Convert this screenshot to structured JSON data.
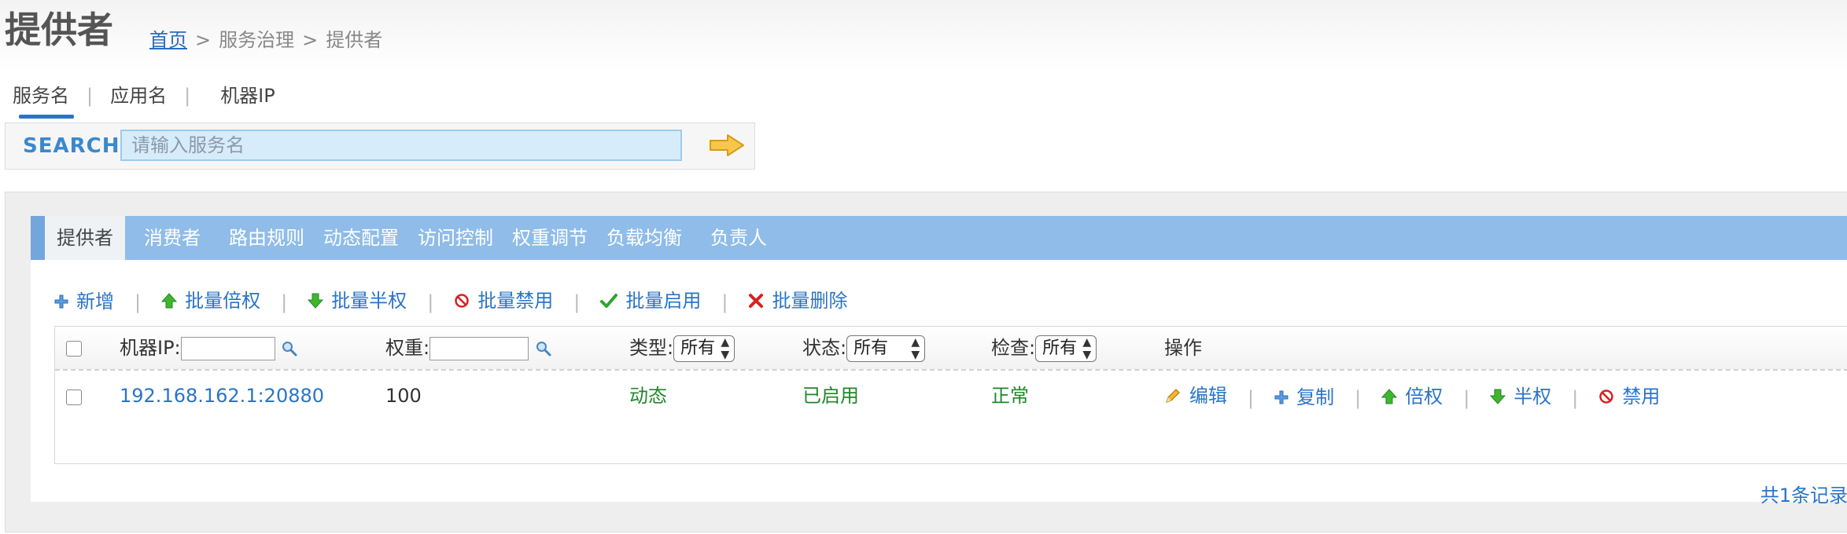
{
  "header": {
    "title": "提供者",
    "breadcrumb": {
      "home": "首页",
      "sep1": ">",
      "level2": "服务治理",
      "sep2": ">",
      "level3": "提供者"
    }
  },
  "search_tabs": {
    "items": [
      "服务名",
      "应用名",
      "机器IP"
    ],
    "active": "服务名",
    "divider": "|"
  },
  "search": {
    "label": "SEARCH",
    "placeholder": "请输入服务名",
    "value": ""
  },
  "tabs": {
    "items": [
      "提供者",
      "消费者",
      "路由规则",
      "动态配置",
      "访问控制",
      "权重调节",
      "负载均衡",
      "负责人"
    ],
    "active": "提供者"
  },
  "toolbar": {
    "add": "新增",
    "batch_double": "批量倍权",
    "batch_half": "批量半权",
    "batch_disable": "批量禁用",
    "batch_enable": "批量启用",
    "batch_delete": "批量删除",
    "divider": "|"
  },
  "table": {
    "headers": {
      "ip": "机器IP:",
      "weight": "权重:",
      "type": "类型:",
      "status": "状态:",
      "check": "检查:",
      "actions": "操作"
    },
    "filters": {
      "type": "所有",
      "status": "所有",
      "check": "所有"
    },
    "rows": [
      {
        "ip": "192.168.162.1:20880",
        "weight": "100",
        "type": "动态",
        "status": "已启用",
        "check": "正常",
        "actions": [
          "编辑",
          "复制",
          "倍权",
          "半权",
          "禁用"
        ]
      }
    ]
  },
  "footer": {
    "total": "共1条记录"
  },
  "colors": {
    "accent_blue": "#2a74c8",
    "tab_bar": "#8fbce9",
    "ok_green": "#22862b",
    "danger_red": "#d92020"
  }
}
